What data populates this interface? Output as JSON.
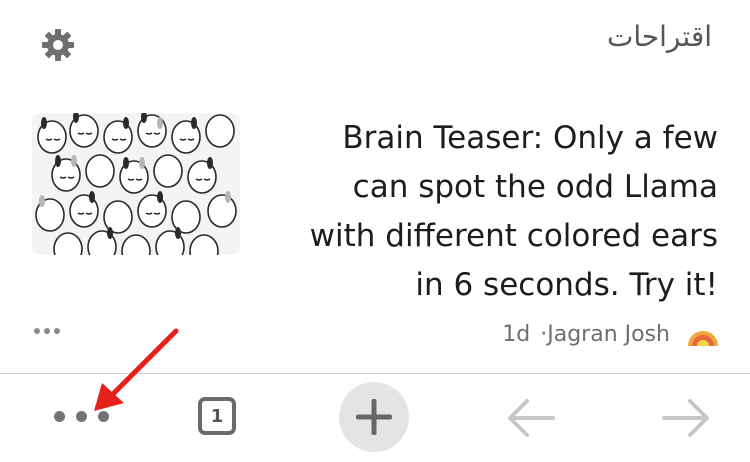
{
  "header": {
    "section_title": "اقتراحات",
    "settings_icon": "gear-icon"
  },
  "card": {
    "headline": "Brain Teaser: Only a few can spot the odd Llama with different colored ears in 6 seconds. Try it!",
    "age": "1d",
    "source": "·Jagran Josh",
    "source_logo_icon": "sunrise-logo-icon",
    "more_icon": "ellipsis-icon"
  },
  "toolbar": {
    "tab_count": "1",
    "more_icon": "ellipsis-icon",
    "new_tab_icon": "plus-icon",
    "back_icon": "back-arrow-icon",
    "forward_icon": "forward-arrow-icon"
  },
  "colors": {
    "annotation_arrow": "#e8201c",
    "toolbar_icon": "#737373",
    "disabled_arrow": "#c7c7c7"
  }
}
